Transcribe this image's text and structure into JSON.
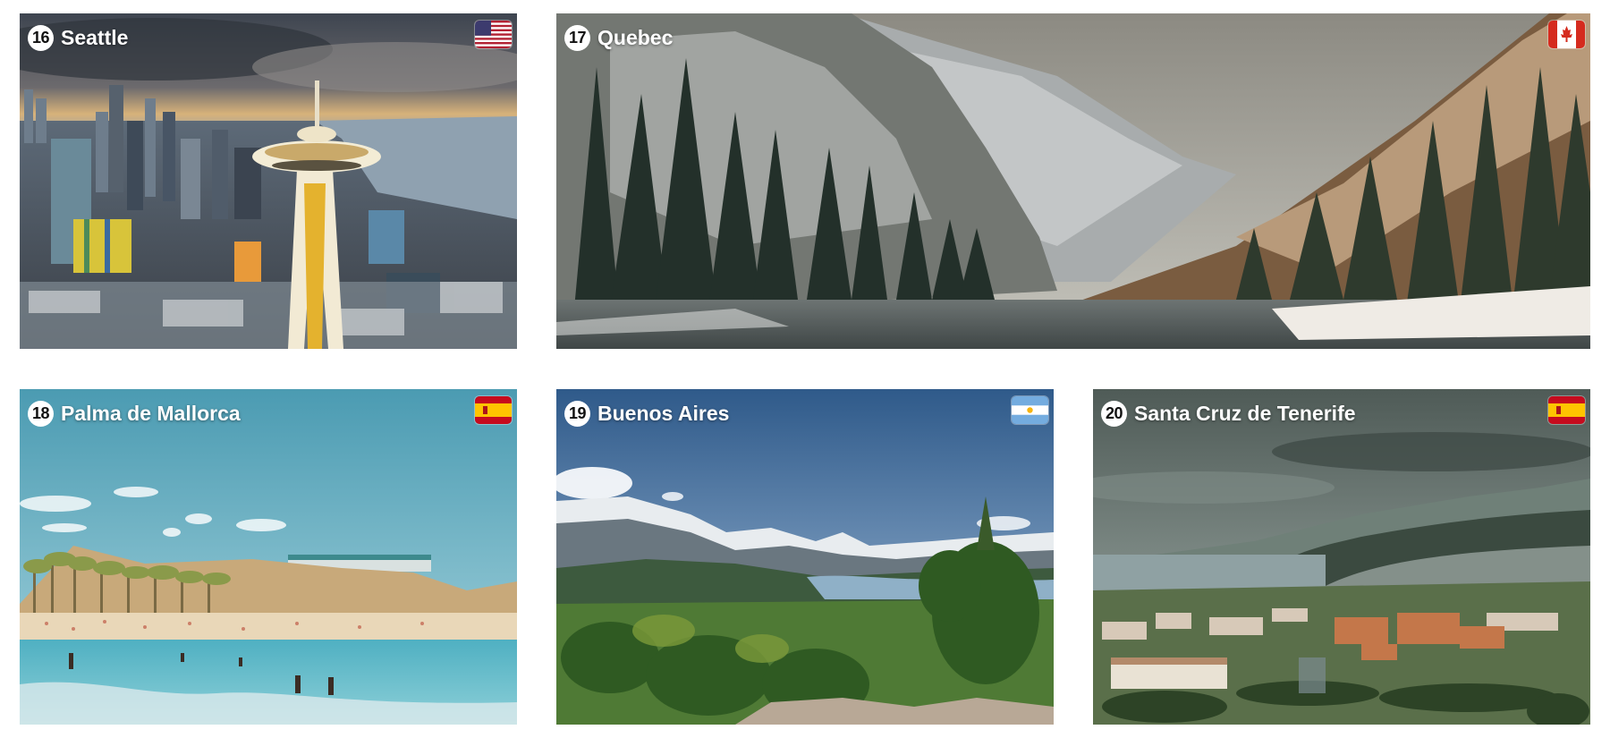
{
  "cards": [
    {
      "number": "16",
      "city": "Seattle",
      "flag": "us-flag-icon",
      "country_colors": [
        "#b22234",
        "#ffffff",
        "#3c3b6e"
      ]
    },
    {
      "number": "17",
      "city": "Quebec",
      "flag": "canada-flag-icon",
      "country_colors": [
        "#d52b1e",
        "#ffffff"
      ]
    },
    {
      "number": "18",
      "city": "Palma de Mallorca",
      "flag": "spain-flag-icon",
      "country_colors": [
        "#c60b1e",
        "#ffc400"
      ]
    },
    {
      "number": "19",
      "city": "Buenos Aires",
      "flag": "argentina-flag-icon",
      "country_colors": [
        "#74acdf",
        "#ffffff",
        "#f6b40e"
      ]
    },
    {
      "number": "20",
      "city": "Santa Cruz de Tenerife",
      "flag": "spain-flag-icon",
      "country_colors": [
        "#c60b1e",
        "#ffc400"
      ]
    }
  ]
}
